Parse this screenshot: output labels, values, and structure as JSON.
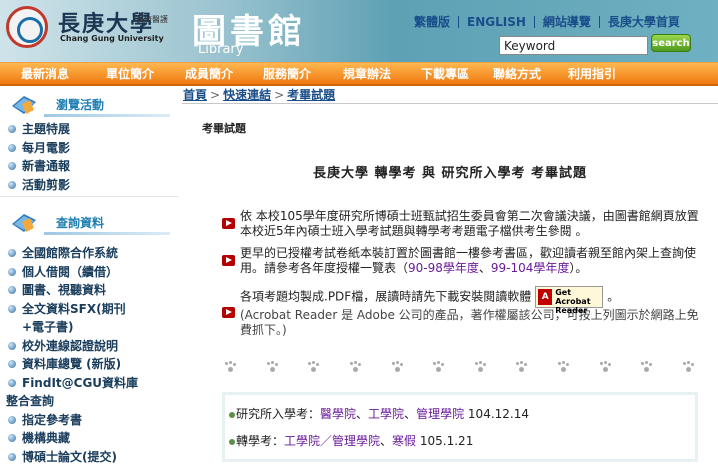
{
  "header": {
    "university_name": "長庚大學",
    "university_subtitle": "長庚醫護",
    "university_en": "Chang Gung University",
    "library_title": "圖書館",
    "library_en": "Library",
    "top_links": [
      "繁體版",
      "ENGLISH",
      "網站導覽",
      "長庚大學首頁"
    ],
    "search": {
      "value": "Keyword",
      "button": "search"
    }
  },
  "nav": {
    "items": [
      "最新消息",
      "單位簡介",
      "成員簡介",
      "服務簡介",
      "規章辦法",
      "下載專區",
      "聯絡方式",
      "利用指引"
    ]
  },
  "sidebar": {
    "sections": [
      {
        "title": "瀏覽活動",
        "items": [
          "主題特展",
          "每月電影",
          "新書通報",
          "活動剪影"
        ]
      },
      {
        "title": "查詢資料",
        "items": [
          "全國館際合作系統",
          "個人借閱（續借）",
          "圖書、視聽資料",
          "全文資料SFX(期刊",
          "+電子書)",
          "校外連線認證說明",
          "資料庫總覽 (新版)",
          "FindIt@CGU資料庫",
          "整合查詢",
          "指定參考書",
          "機構典藏",
          "博碩士論文(提交)"
        ]
      }
    ]
  },
  "main": {
    "breadcrumb": [
      "首頁",
      "快速連結",
      "考畢試題"
    ],
    "section_heading": "考畢試題",
    "content_title": "長庚大學 轉學考 與 研究所入學考 考畢試題",
    "paragraphs": {
      "p1": "依 本校105學年度研究所博碩士班甄試招生委員會第二次會議決議，由圖書館網頁放置本校近5年內碩士班入學考試題與轉學考考題電子檔供考生參閱 。",
      "p2_text": "更早的已授權考試卷紙本裝訂置於圖書館一樓參考書區，歡迎讀者親至館內架上查詢使用。請參考各年度授權一覽表（",
      "p2_link1": "90-98學年度",
      "p2_sep": "、",
      "p2_link2": "99-104學年度",
      "p2_end": "）。",
      "p3_text": "各項考題均製成.PDF檔，展讀時請先下載安裝閱讀軟體",
      "p3_end": "。",
      "p3_note": "(Acrobat Reader 是 Adobe 公司的產品，著作權屬該公司，可按上列圖示於網路上免費抓下。)"
    },
    "acrobat_badge": {
      "logo": "A",
      "line1": "Get Acrobat",
      "line2": "Reader"
    },
    "exam_rows": [
      {
        "label": "研究所入學考：",
        "links": [
          "醫學院",
          "工學院",
          "管理學院"
        ],
        "separators": [
          "、",
          "、"
        ],
        "date": "104.12.14"
      },
      {
        "label": "轉學考：",
        "links": [
          "工學院／管理學院",
          "寒假"
        ],
        "separators": [
          "、"
        ],
        "date": "105.1.21"
      }
    ]
  },
  "colors": {
    "nav_orange": "#f07a10",
    "link_blue": "#1a4e8a",
    "sidebar_title_blue": "#1f7fb3",
    "link_purple": "#6a1b9a",
    "bullet_red": "#b30000"
  }
}
